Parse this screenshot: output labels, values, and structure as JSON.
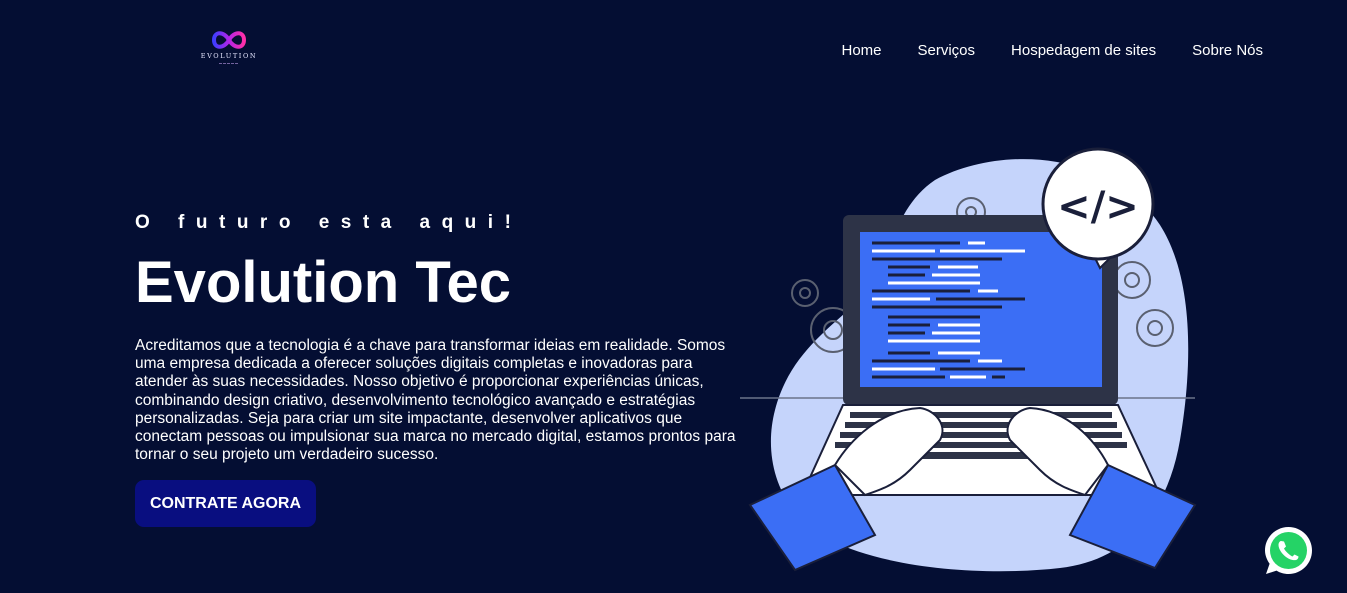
{
  "header": {
    "logo_text": "EVOLUTION",
    "nav": [
      {
        "label": "Home"
      },
      {
        "label": "Serviços"
      },
      {
        "label": "Hospedagem de sites"
      },
      {
        "label": "Sobre Nós"
      }
    ]
  },
  "hero": {
    "tagline": "O futuro esta aqui!",
    "title": "Evolution Tec",
    "description": "Acreditamos que a tecnologia é a chave para transformar ideias em realidade. Somos uma empresa dedicada a oferecer soluções digitais completas e inovadoras para atender às suas necessidades. Nosso objetivo é proporcionar experiências únicas, combinando design criativo, desenvolvimento tecnológico avançado e estratégias personalizadas. Seja para criar um site impactante, desenvolver aplicativos que conectam pessoas ou impulsionar sua marca no mercado digital, estamos prontos para tornar o seu projeto um verdadeiro sucesso.",
    "cta_label": "CONTRATE AGORA"
  },
  "illustration": {
    "code_bubble_text": "</>",
    "icons": [
      "laptop-coding-illustration",
      "gear-icon",
      "code-icon"
    ]
  },
  "whatsapp": {
    "icon": "whatsapp-icon"
  },
  "colors": {
    "background": "#040e33",
    "button": "#090e80",
    "accent_blue": "#3b6ef5",
    "blob": "#c5d4fb"
  }
}
